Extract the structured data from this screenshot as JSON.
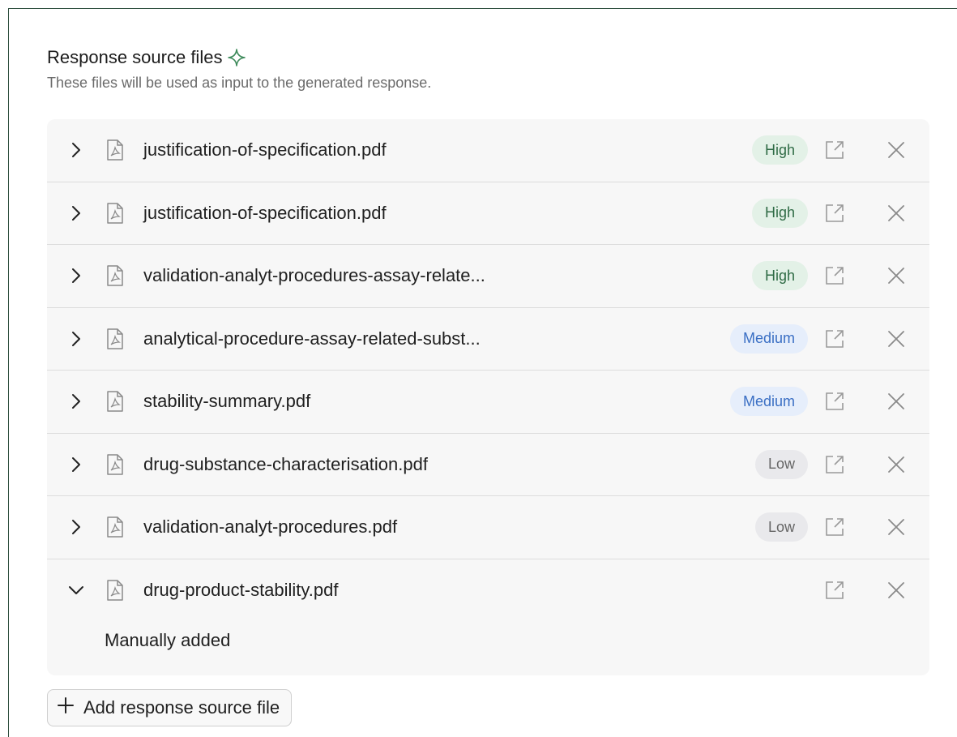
{
  "header": {
    "title": "Response source files",
    "subtitle": "These files will be used as input to the generated response."
  },
  "files": [
    {
      "name": "justification-of-specification.pdf",
      "relevance": "High",
      "relevance_level": "high",
      "expanded": false
    },
    {
      "name": "justification-of-specification.pdf",
      "relevance": "High",
      "relevance_level": "high",
      "expanded": false
    },
    {
      "name": "validation-analyt-procedures-assay-relate...",
      "relevance": "High",
      "relevance_level": "high",
      "expanded": false
    },
    {
      "name": "analytical-procedure-assay-related-subst...",
      "relevance": "Medium",
      "relevance_level": "medium",
      "expanded": false
    },
    {
      "name": "stability-summary.pdf",
      "relevance": "Medium",
      "relevance_level": "medium",
      "expanded": false
    },
    {
      "name": "drug-substance-characterisation.pdf",
      "relevance": "Low",
      "relevance_level": "low",
      "expanded": false
    },
    {
      "name": "validation-analyt-procedures.pdf",
      "relevance": "Low",
      "relevance_level": "low",
      "expanded": false
    },
    {
      "name": "drug-product-stability.pdf",
      "relevance": "",
      "relevance_level": "",
      "expanded": true,
      "note": "Manually added"
    }
  ],
  "add_button": {
    "label": "Add response source file"
  },
  "icons": {
    "title": "sparkle-icon",
    "expand": "chevron-right-icon",
    "collapse": "chevron-down-icon",
    "file": "pdf-file-icon",
    "open": "open-external-icon",
    "remove": "close-icon",
    "add": "plus-icon"
  },
  "colors": {
    "frame_border": "#2f4f3f",
    "sparkle": "#3d8a5a",
    "high_bg": "#e3f1e7",
    "high_text": "#2f6b45",
    "medium_bg": "#e6eefb",
    "medium_text": "#3a6fc4",
    "low_bg": "#e9e9ec",
    "low_text": "#666666"
  }
}
